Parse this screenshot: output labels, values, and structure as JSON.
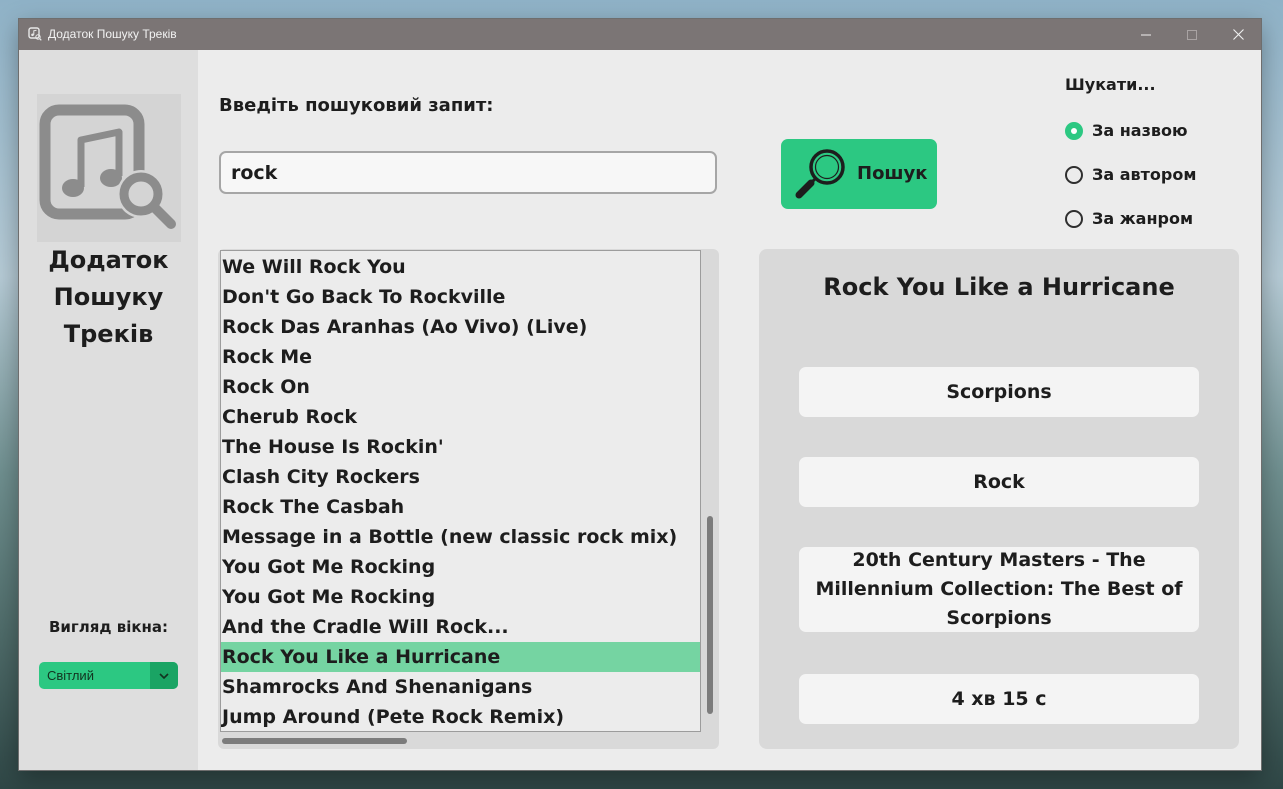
{
  "window": {
    "title": "Додаток Пошуку Треків",
    "controls": {
      "minimize": "minimize",
      "maximize": "maximize",
      "close": "close"
    }
  },
  "sidebar": {
    "app_name_lines": [
      "Додаток",
      "Пошуку",
      "Треків"
    ],
    "theme_label": "Вигляд вікна:",
    "theme_value": "Світлий"
  },
  "search": {
    "label": "Введіть пошуковий запит:",
    "query": "rock",
    "button_label": "Пошук"
  },
  "search_by": {
    "label": "Шукати...",
    "options": [
      {
        "label": "За назвою",
        "checked": true
      },
      {
        "label": "За автором",
        "checked": false
      },
      {
        "label": "За жанром",
        "checked": false
      }
    ]
  },
  "results": {
    "items": [
      "We Will Rock You",
      "Don't Go Back To Rockville",
      "Rock Das Aranhas (Ao Vivo) (Live)",
      "Rock Me",
      "Rock On",
      "Cherub Rock",
      "The House Is Rockin'",
      "Clash City Rockers",
      "Rock The Casbah",
      "Message in a Bottle (new classic rock mix)",
      "You Got Me Rocking",
      "You Got Me Rocking",
      "And the Cradle Will Rock...",
      "Rock You Like a Hurricane",
      "Shamrocks And Shenanigans",
      "Jump Around (Pete Rock Remix)"
    ],
    "selected_index": 13
  },
  "details": {
    "title": "Rock You Like a Hurricane",
    "artist": "Scorpions",
    "genre": "Rock",
    "album": "20th Century Masters - The Millennium Collection: The Best of Scorpions",
    "duration": "4 хв 15 с"
  },
  "colors": {
    "accent": "#2cc882",
    "accent_dark": "#1aa464",
    "selection": "#75d4a2",
    "titlebar": "#7b7575"
  }
}
